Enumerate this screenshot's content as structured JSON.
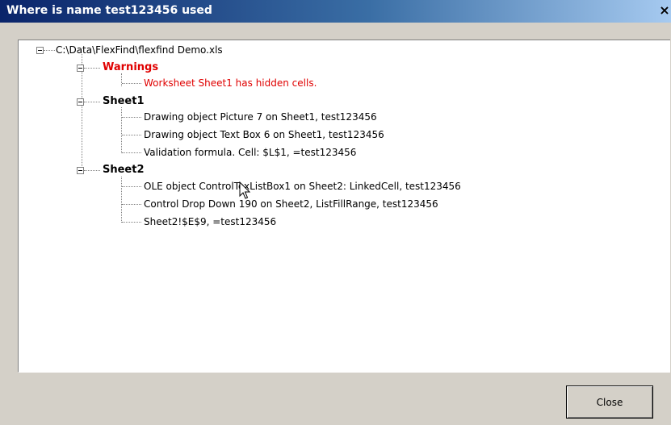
{
  "window": {
    "title": "Where is name test123456 used",
    "close_glyph": "×"
  },
  "tree": {
    "root": "C:\\Data\\FlexFind\\flexfind Demo.xls",
    "warnings": {
      "label": "Warnings",
      "items": [
        "Worksheet Sheet1 has hidden cells."
      ]
    },
    "sheet1": {
      "label": "Sheet1",
      "items": [
        "Drawing object Picture 7 on Sheet1, test123456",
        "Drawing object Text Box 6 on Sheet1, test123456",
        "Validation formula. Cell: $L$1, =test123456"
      ]
    },
    "sheet2": {
      "label": "Sheet2",
      "items": [
        "OLE object ControlToxListBox1 on Sheet2: LinkedCell, test123456",
        "Control Drop Down 190 on Sheet2, ListFillRange, test123456",
        "Sheet2!$E$9, =test123456"
      ]
    }
  },
  "buttons": {
    "close": "Close"
  },
  "colors": {
    "warning": "#e00000",
    "titlebar_start": "#0a246a",
    "titlebar_end": "#a6caf0"
  }
}
